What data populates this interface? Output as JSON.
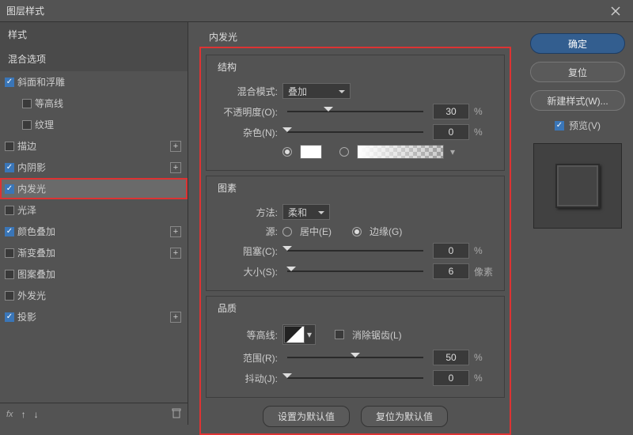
{
  "title": "图层样式",
  "sidebar": {
    "header_styles": "样式",
    "header_blend": "混合选项",
    "items": [
      {
        "label": "斜面和浮雕",
        "checked": true,
        "add": false,
        "sub": false
      },
      {
        "label": "等高线",
        "checked": false,
        "add": false,
        "sub": true
      },
      {
        "label": "纹理",
        "checked": false,
        "add": false,
        "sub": true
      },
      {
        "label": "描边",
        "checked": false,
        "add": true,
        "sub": false
      },
      {
        "label": "内阴影",
        "checked": true,
        "add": true,
        "sub": false
      },
      {
        "label": "内发光",
        "checked": true,
        "add": false,
        "sub": false,
        "selected": true
      },
      {
        "label": "光泽",
        "checked": false,
        "add": false,
        "sub": false
      },
      {
        "label": "颜色叠加",
        "checked": true,
        "add": true,
        "sub": false
      },
      {
        "label": "渐变叠加",
        "checked": false,
        "add": true,
        "sub": false
      },
      {
        "label": "图案叠加",
        "checked": false,
        "add": false,
        "sub": false
      },
      {
        "label": "外发光",
        "checked": false,
        "add": false,
        "sub": false
      },
      {
        "label": "投影",
        "checked": true,
        "add": true,
        "sub": false
      }
    ],
    "footer_fx": "fx"
  },
  "panel": {
    "title": "内发光",
    "g1": {
      "title": "结构",
      "blend_label": "混合模式:",
      "blend_value": "叠加",
      "opacity_label": "不透明度(O):",
      "opacity_value": "30",
      "opacity_unit": "%",
      "noise_label": "杂色(N):",
      "noise_value": "0",
      "noise_unit": "%"
    },
    "g2": {
      "title": "图素",
      "tech_label": "方法:",
      "tech_value": "柔和",
      "source_label": "源:",
      "source_center": "居中(E)",
      "source_edge": "边缘(G)",
      "choke_label": "阻塞(C):",
      "choke_value": "0",
      "choke_unit": "%",
      "size_label": "大小(S):",
      "size_value": "6",
      "size_unit": "像素"
    },
    "g3": {
      "title": "品质",
      "contour_label": "等高线:",
      "aa_label": "消除锯齿(L)",
      "range_label": "范围(R):",
      "range_value": "50",
      "range_unit": "%",
      "jitter_label": "抖动(J):",
      "jitter_value": "0",
      "jitter_unit": "%"
    },
    "btn_default": "设置为默认值",
    "btn_reset": "复位为默认值"
  },
  "right": {
    "ok": "确定",
    "cancel": "复位",
    "new_style": "新建样式(W)...",
    "preview_label": "预览(V)"
  }
}
